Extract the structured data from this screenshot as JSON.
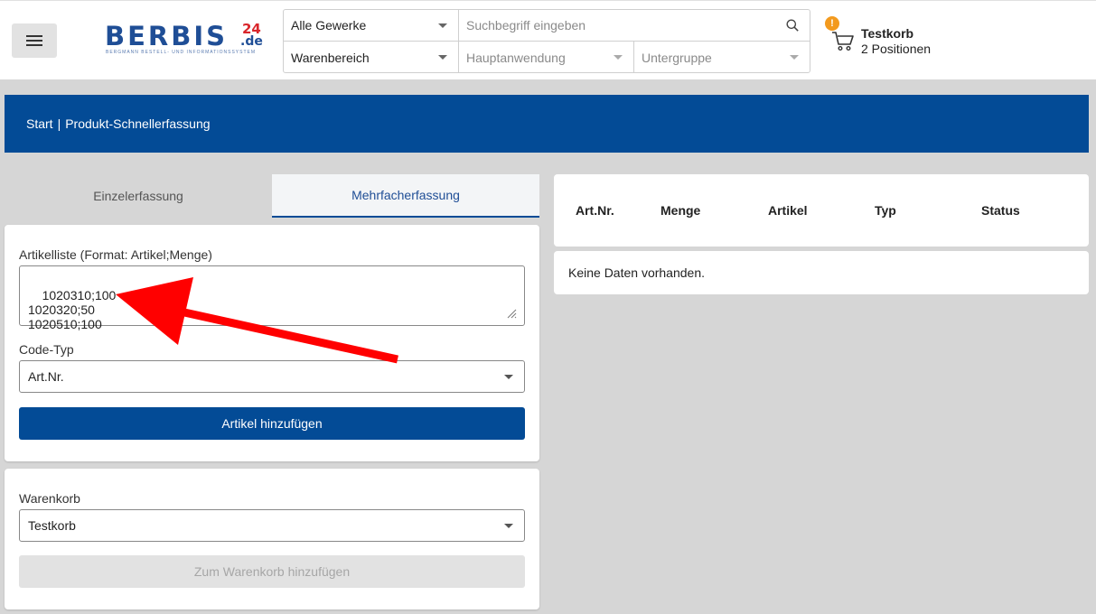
{
  "header": {
    "logo": {
      "word": "BERBIS",
      "num": "24",
      "domain": ".de",
      "tagline": "BERGMANN BESTELL- UND INFORMATIONSSYSTEM"
    },
    "search": {
      "trade_select": "Alle Gewerke",
      "query_placeholder": "Suchbegriff eingeben",
      "category_select": "Warenbereich",
      "application_select": "Hauptanwendung",
      "subgroup_select": "Untergruppe"
    },
    "cart": {
      "badge": "!",
      "name": "Testkorb",
      "count": "2 Positionen"
    }
  },
  "breadcrumb": {
    "home": "Start",
    "separator": "|",
    "current": "Produkt-Schnellerfassung"
  },
  "tabs": [
    {
      "label": "Einzelerfassung",
      "active": false
    },
    {
      "label": "Mehrfacherfassung",
      "active": true
    }
  ],
  "form": {
    "list_label": "Artikelliste (Format: Artikel;Menge)",
    "list_value": "1020310;100\n1020320;50\n1020510;100",
    "code_type_label": "Code-Typ",
    "code_type_value": "Art.Nr.",
    "add_button": "Artikel hinzufügen"
  },
  "cart_form": {
    "label": "Warenkorb",
    "value": "Testkorb",
    "add_button": "Zum Warenkorb hinzufügen"
  },
  "table": {
    "columns": [
      "Art.Nr.",
      "Menge",
      "Artikel",
      "Typ",
      "Status"
    ],
    "empty_text": "Keine Daten vorhanden."
  },
  "colors": {
    "brand_blue": "#034b96",
    "badge_orange": "#f39a1e",
    "annotation_red": "#ff0000"
  }
}
